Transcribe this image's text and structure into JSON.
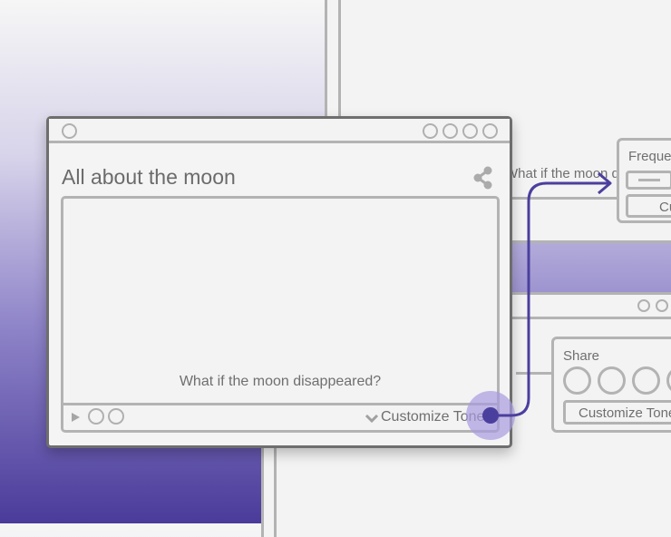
{
  "colors": {
    "accent": "#4b3f9e",
    "accent_light": "#a89be0",
    "frame": "#b3b3b3",
    "surface": "#f3f3f3"
  },
  "main_window": {
    "title": "All about the moon",
    "caption": "What if the moon disappeared?",
    "customize_label": "Customize Tone",
    "share_icon": "share-icon",
    "chevron_icon": "chevron-down-icon"
  },
  "bg_top_window": {
    "caption": "What if the moon disappeared?"
  },
  "frequency_panel": {
    "label": "Frequency",
    "button_label": "Custom"
  },
  "share_panel": {
    "label": "Share",
    "button_label": "Customize Tone"
  }
}
